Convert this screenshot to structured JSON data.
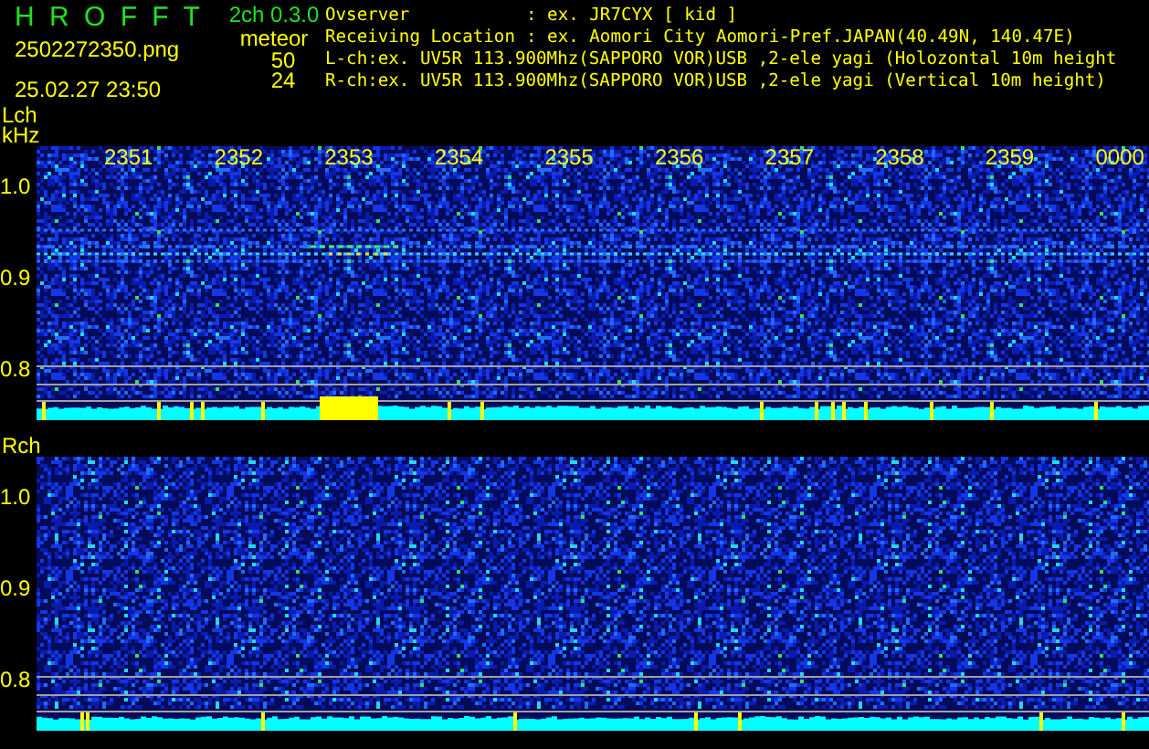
{
  "header": {
    "app_name": "H R O F F T",
    "version": "2ch 0.3.0",
    "filename": "2502272350.png",
    "datetime": "25.02.27 23:50",
    "meteor_label": "meteor",
    "counts": [
      "50",
      "24"
    ]
  },
  "info": [
    {
      "label": "Ovserver",
      "value": ": ex. JR7CYX [ kid ]"
    },
    {
      "label": "Receiving Location",
      "value": ": ex. Aomori City Aomori-Pref.JAPAN(40.49N, 140.47E)"
    },
    {
      "label": "L-ch:ex. UV5R 113.900Mhz(SAPPORO VOR)USB ,2-ele yagi (Holozontal 10m height"
    },
    {
      "label": "R-ch:ex. UV5R 113.900Mhz(SAPPORO VOR)USB ,2-ele yagi (Vertical 10m height)"
    }
  ],
  "panels": [
    {
      "channel": "Lch",
      "unit": "kHz",
      "time_labels": [
        "2351",
        "2352",
        "2353",
        "2354",
        "2355",
        "2356",
        "2357",
        "2358",
        "2359",
        "0000"
      ],
      "yticks": [
        "1.0",
        "0.9",
        "0.8"
      ]
    },
    {
      "channel": "Rch",
      "yticks": [
        "1.0",
        "0.9",
        "0.8"
      ]
    }
  ]
}
